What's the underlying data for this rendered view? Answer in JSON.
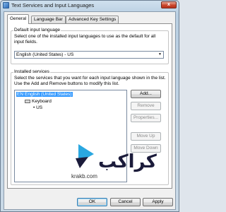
{
  "window": {
    "title": "Text Services and Input Languages",
    "close_label": "x"
  },
  "tabs": [
    {
      "label": "General",
      "active": true
    },
    {
      "label": "Language Bar",
      "active": false
    },
    {
      "label": "Advanced Key Settings",
      "active": false
    }
  ],
  "default_language": {
    "group_label": "Default input language",
    "description": "Select one of the installed input languages to use as the default for all input fields.",
    "selected_value": "English (United States) - US"
  },
  "installed_services": {
    "group_label": "Installed services",
    "description": "Select the services that you want for each input language shown in the list. Use the Add and Remove buttons to modify this list.",
    "tree": {
      "language_code": "EN",
      "language_name": "English (United States)",
      "category": "Keyboard",
      "layout": "US"
    },
    "buttons": {
      "add": "Add...",
      "remove": "Remove",
      "properties": "Properties...",
      "move_up": "Move Up",
      "move_down": "Move Down"
    }
  },
  "footer": {
    "ok": "OK",
    "cancel": "Cancel",
    "apply": "Apply"
  },
  "watermark": {
    "arabic_text": "كراكب",
    "url": "krakb.com"
  }
}
